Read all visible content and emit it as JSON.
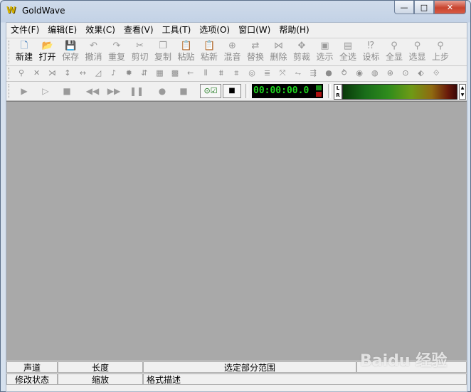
{
  "window": {
    "title": "GoldWave",
    "logo_text": "W",
    "minimize": "—",
    "maximize": "□",
    "close": "✕"
  },
  "menu": [
    "文件(F)",
    "编辑(E)",
    "效果(C)",
    "查看(V)",
    "工具(T)",
    "选项(O)",
    "窗口(W)",
    "帮助(H)"
  ],
  "toolbar": [
    {
      "label": "新建",
      "icon": "new-file-icon",
      "glyph": "🗋",
      "enabled": true
    },
    {
      "label": "打开",
      "icon": "open-folder-icon",
      "glyph": "📂",
      "enabled": true
    },
    {
      "label": "保存",
      "icon": "save-icon",
      "glyph": "💾",
      "enabled": false
    },
    {
      "label": "撤消",
      "icon": "undo-icon",
      "glyph": "↶",
      "enabled": false
    },
    {
      "label": "重复",
      "icon": "redo-icon",
      "glyph": "↷",
      "enabled": false
    },
    {
      "label": "剪切",
      "icon": "cut-icon",
      "glyph": "✂",
      "enabled": false
    },
    {
      "label": "复制",
      "icon": "copy-icon",
      "glyph": "❐",
      "enabled": false
    },
    {
      "label": "粘贴",
      "icon": "paste-icon",
      "glyph": "📋",
      "enabled": false
    },
    {
      "label": "粘新",
      "icon": "paste-new-icon",
      "glyph": "📋",
      "enabled": false
    },
    {
      "label": "混音",
      "icon": "mix-icon",
      "glyph": "⊕",
      "enabled": false
    },
    {
      "label": "替换",
      "icon": "replace-icon",
      "glyph": "⇄",
      "enabled": false
    },
    {
      "label": "删除",
      "icon": "delete-icon",
      "glyph": "⋈",
      "enabled": false
    },
    {
      "label": "剪裁",
      "icon": "trim-icon",
      "glyph": "✥",
      "enabled": false
    },
    {
      "label": "选示",
      "icon": "select-view-icon",
      "glyph": "▣",
      "enabled": false
    },
    {
      "label": "全选",
      "icon": "select-all-icon",
      "glyph": "▤",
      "enabled": false
    },
    {
      "label": "设标",
      "icon": "set-marker-icon",
      "glyph": "⁉",
      "enabled": false
    },
    {
      "label": "全显",
      "icon": "show-all-icon",
      "glyph": "⚲",
      "enabled": false
    },
    {
      "label": "选显",
      "icon": "show-selection-icon",
      "glyph": "⚲",
      "enabled": false
    },
    {
      "label": "上步",
      "icon": "previous-view-icon",
      "glyph": "⚲",
      "enabled": false
    }
  ],
  "effects_toolbar": [
    {
      "icon": "doppler-icon",
      "glyph": "⚲"
    },
    {
      "icon": "dynamics-icon",
      "glyph": "✕"
    },
    {
      "icon": "echo-icon",
      "glyph": "⋊"
    },
    {
      "icon": "equalizer-icon",
      "glyph": "↕"
    },
    {
      "icon": "fade-in-icon",
      "glyph": "↔"
    },
    {
      "icon": "fade-out-icon",
      "glyph": "◿"
    },
    {
      "icon": "filter-icon",
      "glyph": "♪"
    },
    {
      "icon": "flanger-icon",
      "glyph": "✹"
    },
    {
      "icon": "invert-icon",
      "glyph": "⇵"
    },
    {
      "icon": "mechanize-icon",
      "glyph": "▦"
    },
    {
      "icon": "offset-icon",
      "glyph": "▩"
    },
    {
      "icon": "pan-icon",
      "glyph": "←"
    },
    {
      "icon": "pitch-icon",
      "glyph": "⦀"
    },
    {
      "icon": "resample-icon",
      "glyph": "⩩"
    },
    {
      "icon": "reverb-icon",
      "glyph": "⩨"
    },
    {
      "icon": "reverse-icon",
      "glyph": "◎"
    },
    {
      "icon": "silence-icon",
      "glyph": "≣"
    },
    {
      "icon": "smooth-icon",
      "glyph": "⤧"
    },
    {
      "icon": "stereo-icon",
      "glyph": "⥊"
    },
    {
      "icon": "time-warp-icon",
      "glyph": "⇶"
    },
    {
      "icon": "volume-icon",
      "glyph": "●"
    },
    {
      "icon": "volume-shape-icon",
      "glyph": "⥁"
    },
    {
      "icon": "noise-icon",
      "glyph": "◉"
    },
    {
      "icon": "pop-icon",
      "glyph": "◍"
    },
    {
      "icon": "compressor-icon",
      "glyph": "⊛"
    },
    {
      "icon": "expander-icon",
      "glyph": "⊙"
    },
    {
      "icon": "maximize-volume-icon",
      "glyph": "⬖"
    },
    {
      "icon": "match-volume-icon",
      "glyph": "⟐"
    }
  ],
  "transport": [
    {
      "icon": "play-icon",
      "glyph": "▶"
    },
    {
      "icon": "play-selection-icon",
      "glyph": "▷"
    },
    {
      "icon": "stop-icon",
      "glyph": "■"
    },
    {
      "icon": "rewind-icon",
      "glyph": "◀◀"
    },
    {
      "icon": "fast-forward-icon",
      "glyph": "▶▶"
    },
    {
      "icon": "pause-icon",
      "glyph": "❚❚"
    },
    {
      "icon": "record-icon",
      "glyph": "●"
    },
    {
      "icon": "stop-record-icon",
      "glyph": "■"
    }
  ],
  "toggle_box": "⊙☑",
  "window_box": "■",
  "time": "00:00:00.0",
  "led_colors": [
    "#1a8c1a",
    "#b01010"
  ],
  "lr": {
    "l": "L",
    "r": "R"
  },
  "meter_arrows": {
    "up": "▲",
    "down": "▼"
  },
  "status": {
    "row1": [
      "声道",
      "长度",
      "选定部分范围",
      ""
    ],
    "row2": [
      "修改状态",
      "缩放",
      "格式描述"
    ]
  },
  "watermark": "Baidu 经验"
}
